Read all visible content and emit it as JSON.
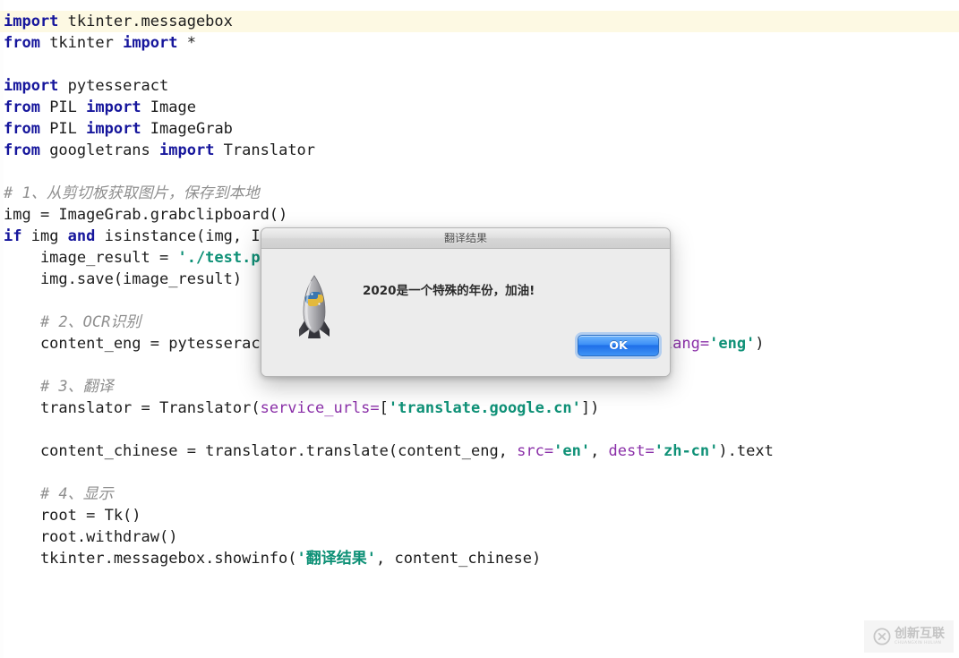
{
  "editor": {
    "current_line_index": 0,
    "lines": [
      {
        "tokens": [
          {
            "t": "import",
            "c": "kw"
          },
          {
            "t": " tkinter.messagebox",
            "c": "plain"
          }
        ]
      },
      {
        "tokens": [
          {
            "t": "from",
            "c": "kw"
          },
          {
            "t": " tkinter ",
            "c": "plain"
          },
          {
            "t": "import",
            "c": "kw"
          },
          {
            "t": " *",
            "c": "plain"
          }
        ]
      },
      {
        "tokens": []
      },
      {
        "tokens": [
          {
            "t": "import",
            "c": "kw"
          },
          {
            "t": " pytesseract",
            "c": "plain"
          }
        ]
      },
      {
        "tokens": [
          {
            "t": "from",
            "c": "kw"
          },
          {
            "t": " PIL ",
            "c": "plain"
          },
          {
            "t": "import",
            "c": "kw"
          },
          {
            "t": " Image",
            "c": "plain"
          }
        ]
      },
      {
        "tokens": [
          {
            "t": "from",
            "c": "kw"
          },
          {
            "t": " PIL ",
            "c": "plain"
          },
          {
            "t": "import",
            "c": "kw"
          },
          {
            "t": " ImageGrab",
            "c": "plain"
          }
        ]
      },
      {
        "tokens": [
          {
            "t": "from",
            "c": "kw"
          },
          {
            "t": " googletrans ",
            "c": "plain"
          },
          {
            "t": "import",
            "c": "kw"
          },
          {
            "t": " Translator",
            "c": "plain"
          }
        ]
      },
      {
        "tokens": []
      },
      {
        "tokens": [
          {
            "t": "# 1、从剪切板获取图片，保存到本地",
            "c": "cmt"
          }
        ]
      },
      {
        "tokens": [
          {
            "t": "img = ImageGrab.grabclipboard()",
            "c": "plain"
          }
        ]
      },
      {
        "tokens": [
          {
            "t": "if",
            "c": "kw"
          },
          {
            "t": " img ",
            "c": "plain"
          },
          {
            "t": "and",
            "c": "kw"
          },
          {
            "t": " isinstance(img, Image.Image):",
            "c": "plain"
          }
        ]
      },
      {
        "tokens": [
          {
            "t": "    image_result = ",
            "c": "plain"
          },
          {
            "t": "'./test.png'",
            "c": "str"
          }
        ]
      },
      {
        "tokens": [
          {
            "t": "    img.save(image_result)",
            "c": "plain"
          }
        ]
      },
      {
        "tokens": []
      },
      {
        "tokens": [
          {
            "t": "    # 2、OCR识别",
            "c": "cmt"
          }
        ]
      },
      {
        "tokens": [
          {
            "t": "    content_eng = pytesseract.image_to_string(Image.open(image_result), ",
            "c": "plain"
          },
          {
            "t": "lang=",
            "c": "arg"
          },
          {
            "t": "'eng'",
            "c": "str"
          },
          {
            "t": ")",
            "c": "plain"
          }
        ]
      },
      {
        "tokens": []
      },
      {
        "tokens": [
          {
            "t": "    # 3、翻译",
            "c": "cmt"
          }
        ]
      },
      {
        "tokens": [
          {
            "t": "    translator = Translator(",
            "c": "plain"
          },
          {
            "t": "service_urls=",
            "c": "arg"
          },
          {
            "t": "[",
            "c": "plain"
          },
          {
            "t": "'translate.google.cn'",
            "c": "str"
          },
          {
            "t": "])",
            "c": "plain"
          }
        ]
      },
      {
        "tokens": []
      },
      {
        "tokens": [
          {
            "t": "    content_chinese = translator.translate(content_eng, ",
            "c": "plain"
          },
          {
            "t": "src=",
            "c": "arg"
          },
          {
            "t": "'en'",
            "c": "str"
          },
          {
            "t": ", ",
            "c": "plain"
          },
          {
            "t": "dest=",
            "c": "arg"
          },
          {
            "t": "'zh-cn'",
            "c": "str"
          },
          {
            "t": ").text",
            "c": "plain"
          }
        ]
      },
      {
        "tokens": []
      },
      {
        "tokens": [
          {
            "t": "    # 4、显示",
            "c": "cmt"
          }
        ]
      },
      {
        "tokens": [
          {
            "t": "    root = Tk()",
            "c": "plain"
          }
        ]
      },
      {
        "tokens": [
          {
            "t": "    root.withdraw()",
            "c": "plain"
          }
        ]
      },
      {
        "tokens": [
          {
            "t": "    tkinter.messagebox.showinfo(",
            "c": "plain"
          },
          {
            "t": "'翻译结果'",
            "c": "str"
          },
          {
            "t": ", content_chinese)",
            "c": "plain"
          }
        ]
      }
    ]
  },
  "dialog": {
    "title": "翻译结果",
    "message": "2020是一个特殊的年份，加油!",
    "ok_label": "OK",
    "icon_name": "python-rocket-icon",
    "accent_color": "#3d90f7",
    "background_color": "#ececec"
  },
  "watermark": {
    "cn_text": "创新互联",
    "en_text": "CHUANGXIN HULIAN",
    "logo_letter": "X"
  },
  "theme": {
    "keyword_color": "#16169c",
    "string_color": "#0f9177",
    "comment_color": "#8f8f8f",
    "argument_color": "#8a2fa8",
    "text_color": "#1c1c1c",
    "current_line_bg": "#fdf9e3",
    "editor_bg": "#ffffff"
  }
}
